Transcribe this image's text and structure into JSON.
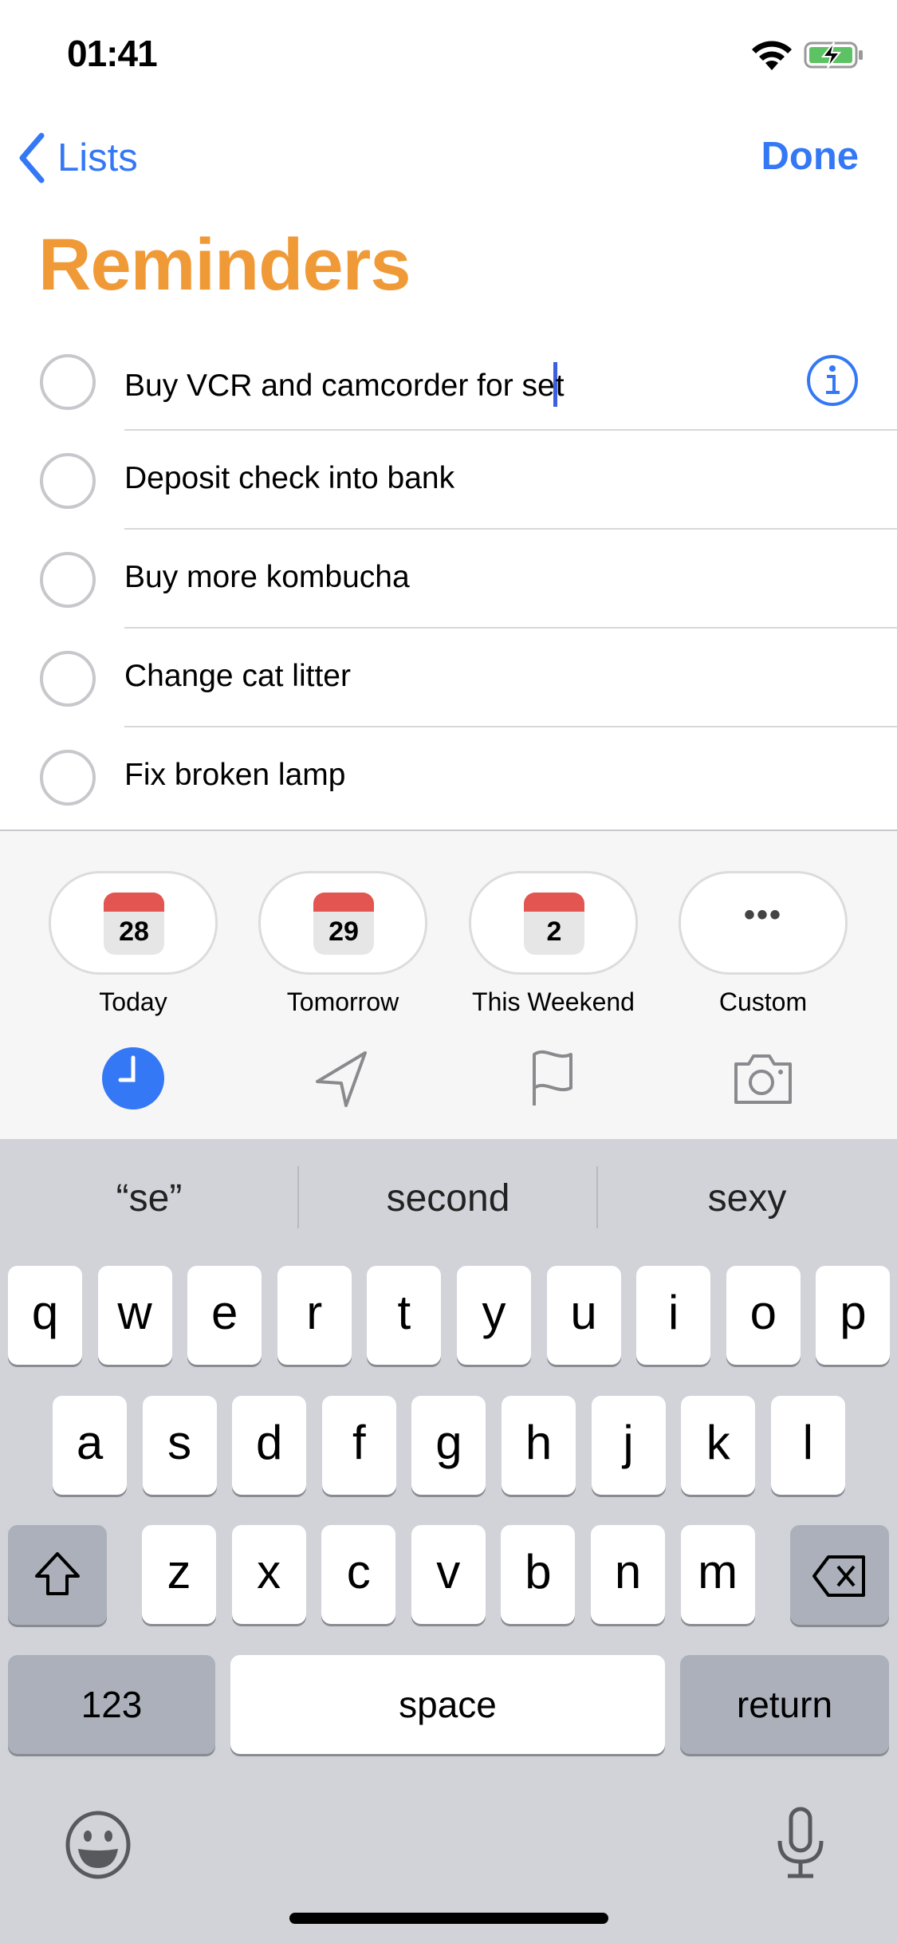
{
  "status_bar": {
    "time": "01:41",
    "wifi_icon": "wifi-icon",
    "battery_icon": "battery-charging-icon"
  },
  "nav": {
    "back_label": "Lists",
    "back_icon": "chevron-left-icon",
    "done_label": "Done"
  },
  "title": "Reminders",
  "colors": {
    "accent": "#3478F6",
    "title": "#F09A37",
    "calendar_red": "#E25550",
    "keyboard_bg": "#D1D3D9"
  },
  "reminders": [
    {
      "text_before_caret": "Buy VCR and camcorder for se",
      "text_after_caret": "t",
      "editing": true
    },
    {
      "text": "Deposit check into bank"
    },
    {
      "text": "Buy more kombucha"
    },
    {
      "text": "Change cat litter"
    },
    {
      "text": "Fix broken lamp"
    }
  ],
  "quick_dates": [
    {
      "day": "28",
      "label": "Today"
    },
    {
      "day": "29",
      "label": "Tomorrow"
    },
    {
      "day": "2",
      "label": "This Weekend"
    },
    {
      "dots": "•••",
      "label": "Custom"
    }
  ],
  "toolbar_icons": [
    "clock-icon",
    "location-arrow-icon",
    "flag-icon",
    "camera-icon"
  ],
  "suggestions": [
    "“se”",
    "second",
    "sexy"
  ],
  "keyboard": {
    "row1": [
      "q",
      "w",
      "e",
      "r",
      "t",
      "y",
      "u",
      "i",
      "o",
      "p"
    ],
    "row2": [
      "a",
      "s",
      "d",
      "f",
      "g",
      "h",
      "j",
      "k",
      "l"
    ],
    "row3": [
      "z",
      "x",
      "c",
      "v",
      "b",
      "n",
      "m"
    ],
    "numbers_label": "123",
    "space_label": "space",
    "return_label": "return"
  }
}
